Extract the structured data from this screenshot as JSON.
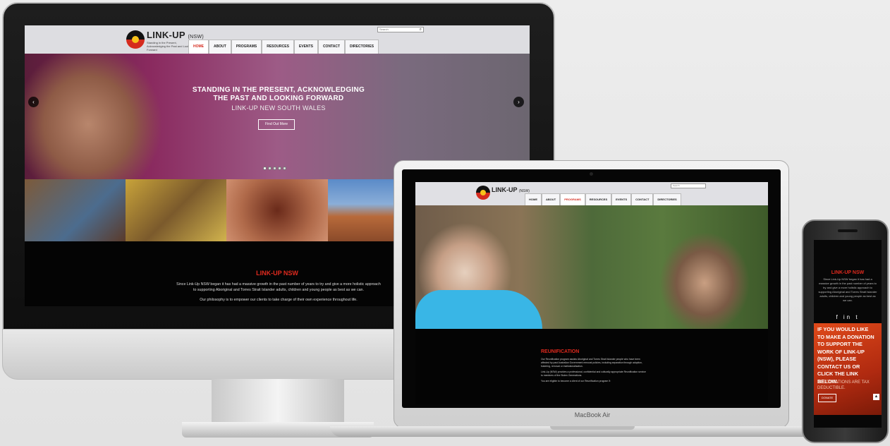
{
  "site": {
    "logo_text": "LINK-UP",
    "logo_suffix": "(NSW)",
    "logo_tagline": "Standing in the Present, Acknowledging the Past and Looking Forward",
    "search_placeholder": "Search",
    "nav": [
      "HOME",
      "ABOUT",
      "PROGRAMS",
      "RESOURCES",
      "EVENTS",
      "CONTACT",
      "DIRECTORIES"
    ]
  },
  "desktop": {
    "hero_headline_1": "STANDING IN THE PRESENT, ACKNOWLEDGING",
    "hero_headline_2": "THE PAST AND LOOKING FORWARD",
    "hero_sub": "LINK-UP NEW SOUTH WALES",
    "hero_button": "Find Out More",
    "prev_arrow": "‹",
    "next_arrow": "›",
    "footer_title": "LINK-UP NSW",
    "footer_text": "Since Link-Up NSW began it has had a massive growth in the past number of years to try and give a more holistic approach to supporting Aboriginal and Torres Strait Islander adults, children and young people as best as we can.",
    "footer_text2": "Our philosophy is to empower our clients to take charge of their own experience throughout life."
  },
  "laptop": {
    "active_nav": "PROGRAMS",
    "section_title": "REUNIFICATION",
    "section_text": "Our Reunification program assists Aboriginal and Torres Strait Islander people who have been affected by past Australian Government removal policies, including separation through adoption, fostering, removal or institutionalisation.",
    "section_text2": "Link-Up (NSW) provides a professional, confidential and culturally appropriate Reunification service to members of the Stolen Generations.",
    "section_text3": "You are eligible to become a client of our Reunification program if:",
    "device_label": "MacBook Air"
  },
  "phone": {
    "title": "LINK-UP NSW",
    "text": "Since Link-Up NSW began it has had a massive growth in the past number of years to try and give a more holistic approach to supporting Aboriginal and Torres Strait Islander adults, children and young people as best as we can.",
    "social": "f in t",
    "donate_text": "IF YOU WOULD LIKE TO MAKE A DONATION TO SUPPORT THE WORK OF LINK-UP (NSW), PLEASE CONTACT US OR CLICK THE LINK BELOW.",
    "donate_note": "ALL DONATIONS ARE TAX DEDUCTIBLE.",
    "donate_button": "DONATE",
    "back_to_top": "▲"
  },
  "colors": {
    "brand_red": "#d52b1e",
    "footer_black": "#040404",
    "donate_orange": "#e04a1a"
  }
}
